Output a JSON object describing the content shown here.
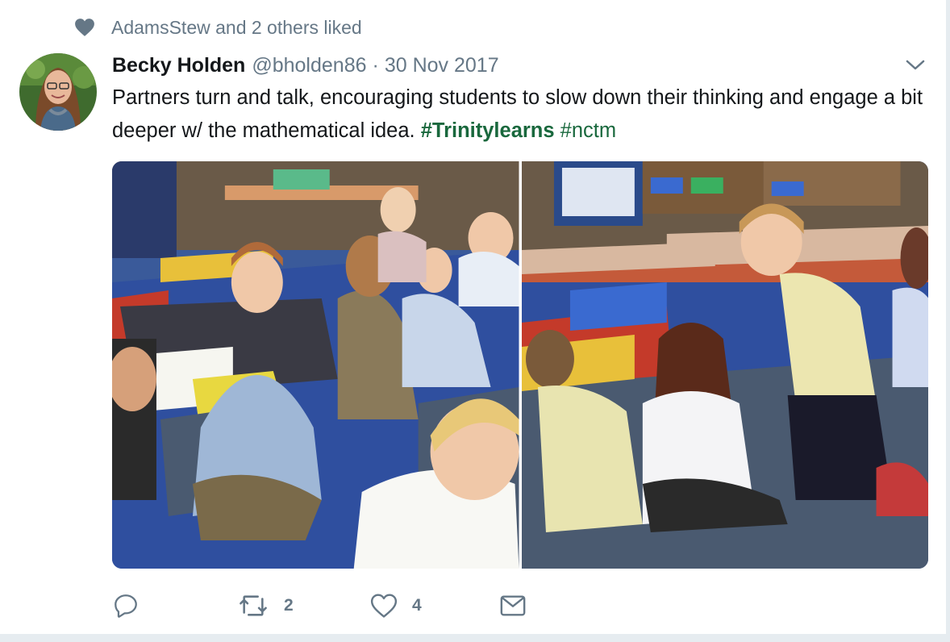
{
  "context": {
    "icon": "heart-icon",
    "text": "AdamsStew and 2 others liked"
  },
  "tweet": {
    "author_name": "Becky Holden",
    "author_handle": "@bholden86",
    "separator": "·",
    "date": "30 Nov 2017",
    "text_main": "Partners turn and talk, encouraging students to slow down their thinking and engage a bit deeper w/ the mathematical idea.",
    "hashtag_1": "#Trinitylearns",
    "hashtag_2": "#nctm",
    "hashtag_color": "#19683d"
  },
  "actions": {
    "reply": {
      "icon": "reply-icon"
    },
    "retweet": {
      "icon": "retweet-icon",
      "count": "2"
    },
    "like": {
      "icon": "heart-outline-icon",
      "count": "4"
    },
    "dm": {
      "icon": "mail-icon"
    }
  },
  "colors": {
    "primary_text": "#14171a",
    "secondary_text": "#657786",
    "border": "#e6ecf0"
  }
}
